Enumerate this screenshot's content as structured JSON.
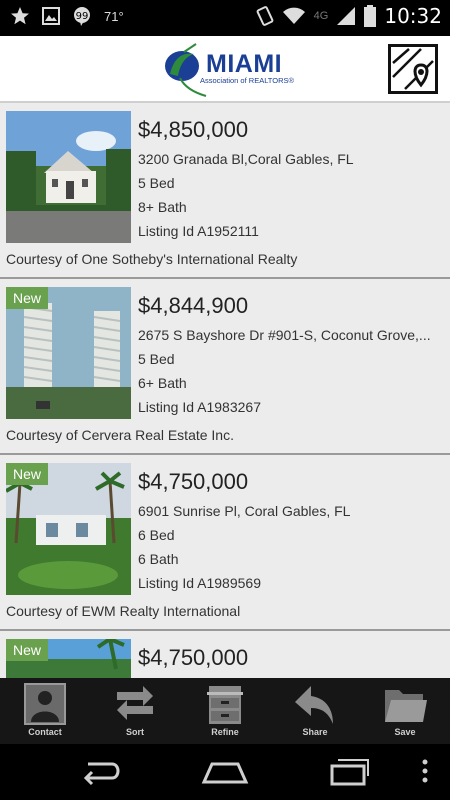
{
  "status": {
    "temperature": "71°",
    "network": "4G",
    "time": "10:32"
  },
  "header": {
    "logo_title": "MIAMI",
    "logo_subtitle": "Association of REALTORS®",
    "map_button": "map-pin-icon"
  },
  "listings": [
    {
      "is_new": false,
      "badge": "",
      "price": "$4,850,000",
      "address": "3200 Granada Bl,Coral Gables, FL",
      "beds": "5 Bed",
      "baths": "8+ Bath",
      "listing_id": "Listing Id A1952111",
      "courtesy": "Courtesy of One Sotheby's International Realty"
    },
    {
      "is_new": true,
      "badge": "New",
      "price": "$4,844,900",
      "address": "2675 S Bayshore Dr #901-S, Coconut Grove,...",
      "beds": "5 Bed",
      "baths": "6+ Bath",
      "listing_id": "Listing Id A1983267",
      "courtesy": "Courtesy of Cervera Real Estate Inc."
    },
    {
      "is_new": true,
      "badge": "New",
      "price": "$4,750,000",
      "address": "6901 Sunrise Pl, Coral Gables, FL",
      "beds": "6 Bed",
      "baths": "6 Bath",
      "listing_id": "Listing Id A1989569",
      "courtesy": "Courtesy of EWM Realty International"
    },
    {
      "is_new": true,
      "badge": "New",
      "price": "$4,750,000"
    }
  ],
  "toolbar": {
    "contact": "Contact",
    "sort": "Sort",
    "refine": "Refine",
    "share": "Share",
    "save": "Save"
  },
  "colors": {
    "brand_blue": "#1b3f94",
    "brand_green": "#2e8b3d",
    "new_badge": "#6aa14f"
  }
}
